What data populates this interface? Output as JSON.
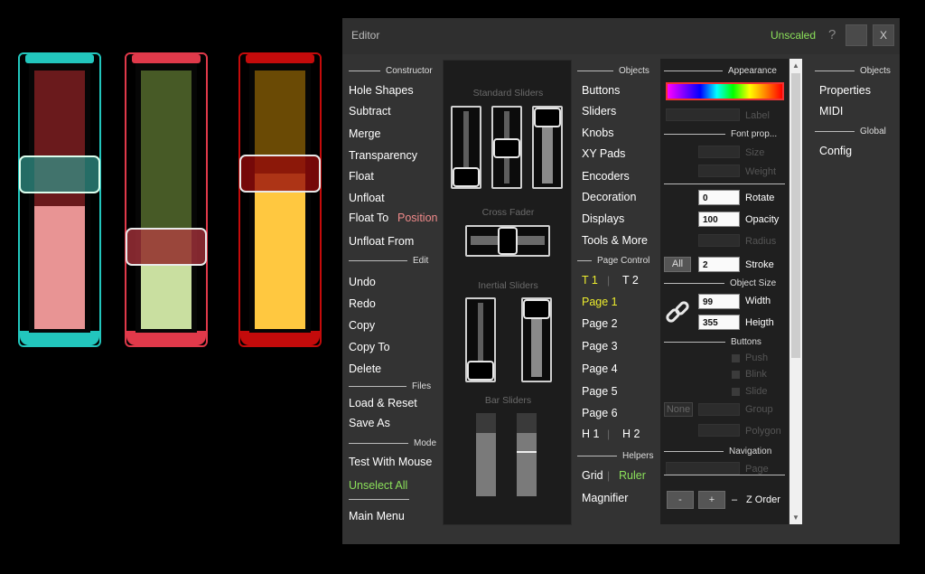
{
  "colors": {
    "teal": "#22c6bd",
    "red": "#e0394a",
    "darkred": "#c40b0b",
    "green_text": "#8be05a",
    "yellow_text": "#ecec2e",
    "pink_text": "#f08a8a"
  },
  "canvas_sliders": [
    {
      "name": "teal-slider",
      "level": 0.6
    },
    {
      "name": "red-slider",
      "level": 0.25
    },
    {
      "name": "darkred-slider",
      "level": 0.6
    }
  ],
  "titlebar": {
    "title": "Editor",
    "scale_label": "Unscaled",
    "help_label": "?",
    "close_label": "X"
  },
  "col1": {
    "constructor": "Constructor",
    "hole_shapes": "Hole Shapes",
    "subtract": "Subtract",
    "merge": "Merge",
    "transparency": "Transparency",
    "float": "Float",
    "unfloat": "Unfloat",
    "float_to": "Float To",
    "position": "Position",
    "unfloat_from": "Unfloat From",
    "edit": "Edit",
    "undo": "Undo",
    "redo": "Redo",
    "copy": "Copy",
    "copy_to": "Copy To",
    "delete": "Delete",
    "files": "Files",
    "load_reset": "Load & Reset",
    "save_as": "Save As",
    "mode": "Mode",
    "test_with_mouse": "Test With Mouse",
    "unselect_all": "Unselect All",
    "main_menu": "Main Menu"
  },
  "sliders_panel": {
    "standard": "Standard Sliders",
    "cross_fader": "Cross Fader",
    "inertial": "Inertial Sliders",
    "bar": "Bar Sliders"
  },
  "col3": {
    "objects": "Objects",
    "buttons": "Buttons",
    "sliders": "Sliders",
    "knobs": "Knobs",
    "xy_pads": "XY Pads",
    "encoders": "Encoders",
    "decoration": "Decoration",
    "displays": "Displays",
    "tools_more": "Tools & More",
    "page_control": "Page Control",
    "t1": "T 1",
    "t2": "T 2",
    "page1": "Page 1",
    "page2": "Page 2",
    "page3": "Page 3",
    "page4": "Page 4",
    "page5": "Page 5",
    "page6": "Page 6",
    "h1": "H 1",
    "h2": "H 2",
    "helpers": "Helpers",
    "grid": "Grid",
    "ruler": "Ruler",
    "magnifier": "Magnifier"
  },
  "appearance": {
    "title": "Appearance",
    "label": "Label",
    "font_prop": "Font prop...",
    "size": "Size",
    "weight": "Weight",
    "rotate_value": "0",
    "rotate": "Rotate",
    "opacity_value": "100",
    "opacity": "Opacity",
    "radius": "Radius",
    "all": "All",
    "stroke_value": "2",
    "stroke": "Stroke",
    "object_size": "Object Size",
    "width_value": "99",
    "width": "Width",
    "height_value": "355",
    "height": "Heigth",
    "buttons": "Buttons",
    "push": "Push",
    "blink": "Blink",
    "slide": "Slide",
    "none": "None",
    "group": "Group",
    "polygon": "Polygon",
    "navigation": "Navigation",
    "page": "Page",
    "minus": "-",
    "plus": "+",
    "dash": "–",
    "z_order": "Z Order"
  },
  "col5": {
    "objects": "Objects",
    "properties": "Properties",
    "midi": "MIDI",
    "global": "Global",
    "config": "Config"
  }
}
